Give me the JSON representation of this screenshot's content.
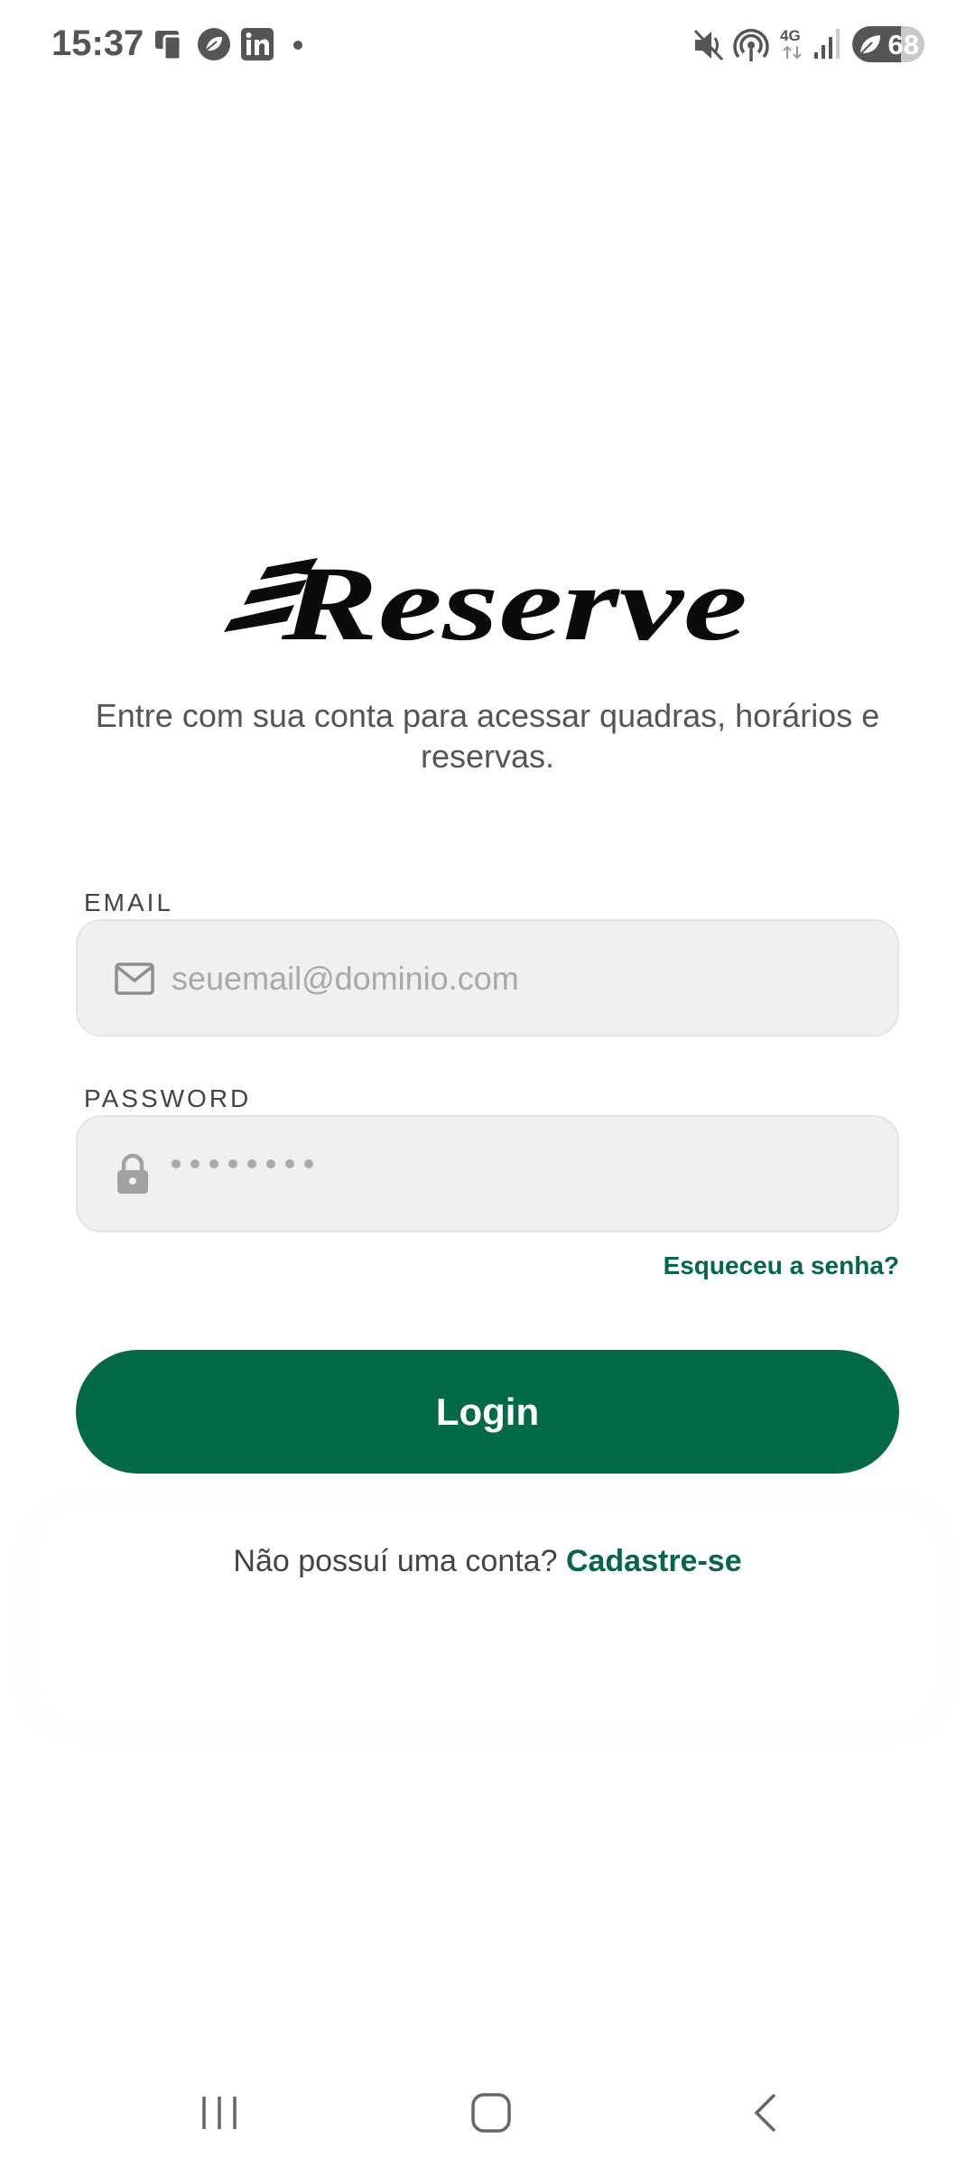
{
  "status_bar": {
    "time": "15:37",
    "network": "4G",
    "battery": "68",
    "battery_level_percent": 68,
    "icons": [
      "screen-mirror-icon",
      "leaf-app-icon",
      "linkedin-icon",
      "dot-icon",
      "mute-icon",
      "hotspot-icon",
      "network-4g-icon",
      "signal-icon",
      "battery-icon"
    ]
  },
  "logo": {
    "text": "Reserve"
  },
  "subtitle": "Entre com sua conta para acessar quadras, horários e reservas.",
  "email": {
    "label": "EMAIL",
    "placeholder": "seuemail@dominio.com",
    "value": ""
  },
  "password": {
    "label": "PASSWORD",
    "masked_length": 8
  },
  "forgot_link": "Esqueceu a senha?",
  "login_button": "Login",
  "signup": {
    "prompt": "Não possuí uma conta?",
    "link": "Cadastre-se"
  },
  "nav_bar": {
    "icons": [
      "recents-icon",
      "home-icon",
      "back-icon"
    ]
  },
  "colors": {
    "primary": "#036a48",
    "link": "#076744",
    "input_bg": "#eff0ef"
  }
}
